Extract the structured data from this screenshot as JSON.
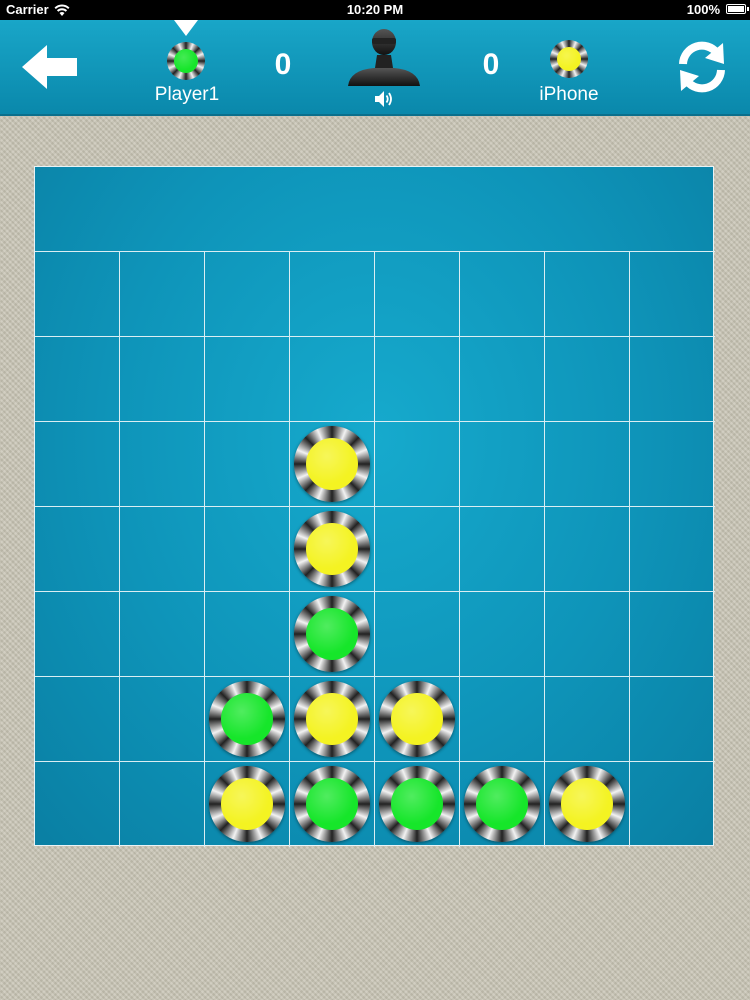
{
  "status_bar": {
    "carrier": "Carrier",
    "time": "10:20 PM",
    "battery": "100%"
  },
  "toolbar": {
    "back_icon": "back-arrow-icon",
    "refresh_icon": "refresh-icon",
    "sound_icon": "speaker-icon",
    "opponent_avatar_icon": "opponent-avatar-icon",
    "current_turn": "player1",
    "player1": {
      "name": "Player1",
      "score": "0",
      "color": "green"
    },
    "player2": {
      "name": "iPhone",
      "score": "0",
      "color": "yellow"
    }
  },
  "colors": {
    "green": "#16e62a",
    "yellow": "#f4f322",
    "board": "#0f95ba",
    "toolbar": "#12a0c3"
  },
  "board": {
    "columns": 8,
    "rows": 7,
    "cells": [
      [
        null,
        null,
        null,
        null,
        null,
        null,
        null,
        null
      ],
      [
        null,
        null,
        null,
        null,
        null,
        null,
        null,
        null
      ],
      [
        null,
        null,
        null,
        "yellow",
        null,
        null,
        null,
        null
      ],
      [
        null,
        null,
        null,
        "yellow",
        null,
        null,
        null,
        null
      ],
      [
        null,
        null,
        null,
        "green",
        null,
        null,
        null,
        null
      ],
      [
        null,
        null,
        "green",
        "yellow",
        "yellow",
        null,
        null,
        null
      ],
      [
        null,
        null,
        "yellow",
        "green",
        "green",
        "green",
        "yellow",
        null
      ]
    ]
  }
}
